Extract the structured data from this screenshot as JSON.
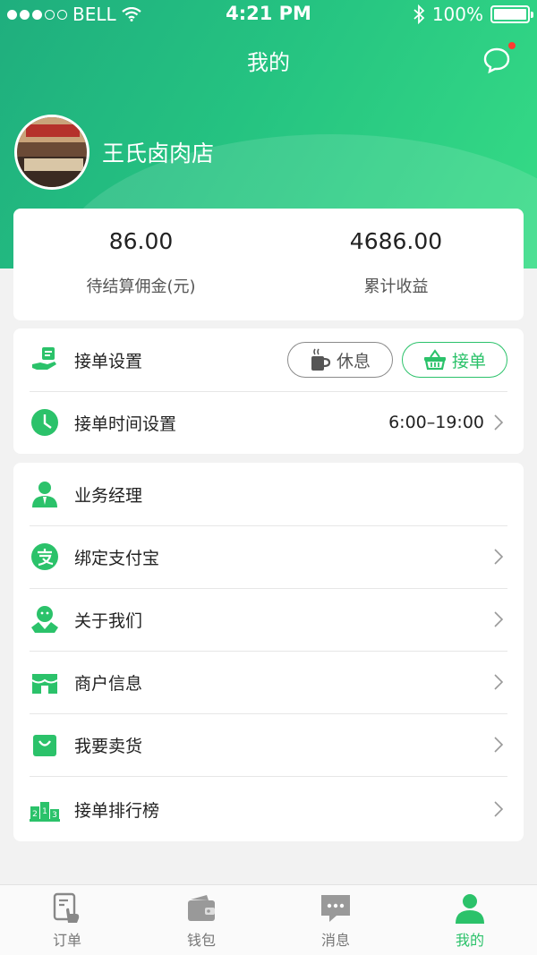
{
  "status_bar": {
    "carrier": "BELL",
    "time": "4:21 PM",
    "battery": "100%"
  },
  "header": {
    "title": "我的"
  },
  "profile": {
    "shop_name": "王氏卤肉店"
  },
  "stats": [
    {
      "value": "86.00",
      "label": "待结算佣金(元)"
    },
    {
      "value": "4686.00",
      "label": "累计收益"
    }
  ],
  "settings": {
    "order_settings_label": "接单设置",
    "rest_label": "休息",
    "accept_label": "接单",
    "time_settings_label": "接单时间设置",
    "time_value": "6:00–19:00"
  },
  "menu": {
    "items": [
      {
        "label": "业务经理",
        "icon": "manager-icon"
      },
      {
        "label": "绑定支付宝",
        "icon": "alipay-icon"
      },
      {
        "label": "关于我们",
        "icon": "about-icon"
      },
      {
        "label": "商户信息",
        "icon": "store-icon"
      },
      {
        "label": "我要卖货",
        "icon": "shopping-bag-icon"
      },
      {
        "label": "接单排行榜",
        "icon": "podium-icon"
      }
    ]
  },
  "tabbar": {
    "items": [
      {
        "label": "订单",
        "icon": "order-icon"
      },
      {
        "label": "钱包",
        "icon": "wallet-icon"
      },
      {
        "label": "消息",
        "icon": "message-icon"
      },
      {
        "label": "我的",
        "icon": "user-icon",
        "active": true
      }
    ]
  },
  "colors": {
    "brand_green": "#2bc26a",
    "header_gradient_start": "#1fae7e",
    "header_gradient_end": "#36dc86"
  }
}
